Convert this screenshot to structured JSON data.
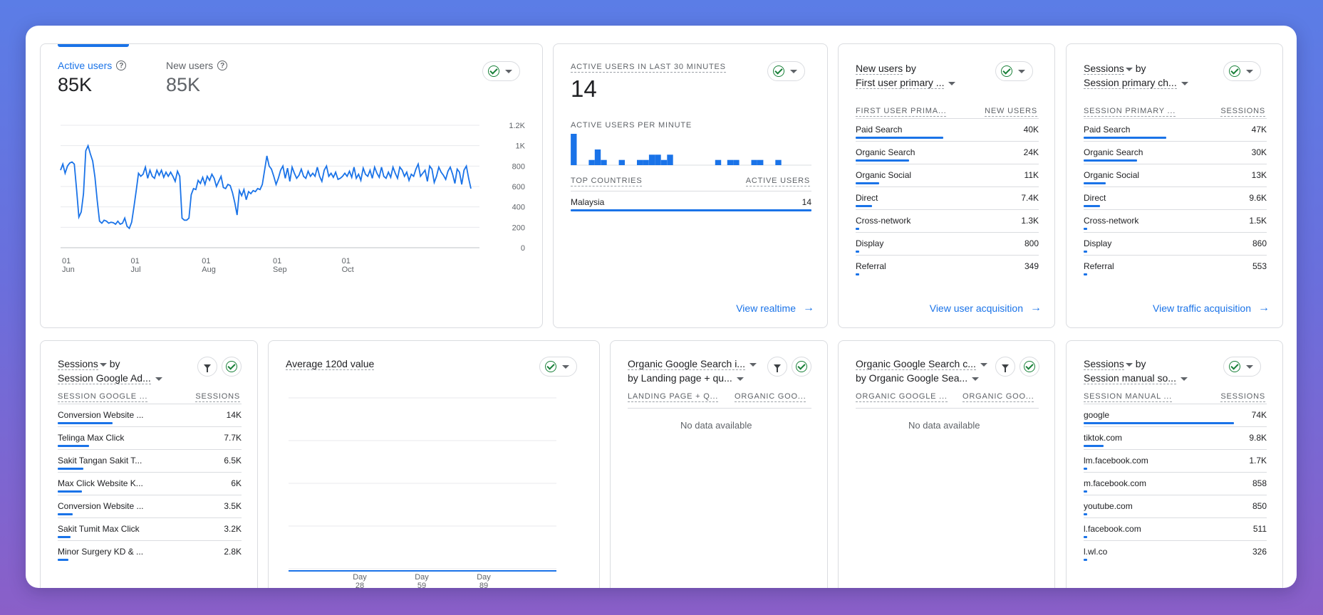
{
  "overview": {
    "metrics": [
      {
        "label": "Active users",
        "value": "85K"
      },
      {
        "label": "New users",
        "value": "85K"
      }
    ],
    "y_ticks": [
      "1.2K",
      "1K",
      "800",
      "600",
      "400",
      "200",
      "0"
    ],
    "x_ticks": [
      {
        "day": "01",
        "month": "Jun"
      },
      {
        "day": "01",
        "month": "Jul"
      },
      {
        "day": "01",
        "month": "Aug"
      },
      {
        "day": "01",
        "month": "Sep"
      },
      {
        "day": "01",
        "month": "Oct"
      }
    ]
  },
  "chart_data": {
    "type": "line",
    "title": "",
    "ylim": [
      0,
      1200
    ],
    "y_tick_values": [
      0,
      200,
      400,
      600,
      800,
      1000,
      1200
    ],
    "series": [
      {
        "name": "Active users",
        "color": "#1a73e8",
        "values": [
          760,
          820,
          730,
          800,
          830,
          840,
          820,
          570,
          300,
          350,
          530,
          950,
          1000,
          920,
          850,
          690,
          460,
          260,
          240,
          270,
          260,
          240,
          250,
          245,
          230,
          260,
          230,
          240,
          290,
          210,
          190,
          250,
          400,
          560,
          730,
          700,
          720,
          790,
          680,
          760,
          700,
          680,
          760,
          710,
          760,
          690,
          740,
          700,
          740,
          700,
          650,
          750,
          700,
          290,
          270,
          270,
          290,
          520,
          580,
          570,
          660,
          630,
          690,
          620,
          700,
          660,
          720,
          680,
          600,
          650,
          700,
          590,
          580,
          620,
          610,
          540,
          440,
          320,
          560,
          510,
          570,
          470,
          550,
          530,
          560,
          550,
          580,
          570,
          620,
          760,
          900,
          800,
          770,
          700,
          620,
          680,
          760,
          800,
          680,
          780,
          650,
          790,
          730,
          680,
          710,
          770,
          700,
          680,
          750,
          700,
          730,
          700,
          790,
          700,
          650,
          760,
          800,
          700,
          730,
          690,
          740,
          670,
          680,
          700,
          730,
          700,
          750,
          690,
          790,
          680,
          720,
          660,
          780,
          720,
          700,
          760,
          680,
          790,
          730,
          690,
          790,
          700,
          680,
          740,
          690,
          790,
          730,
          680,
          790,
          760,
          700,
          740,
          660,
          720,
          700,
          770,
          820,
          700,
          730,
          760,
          650,
          800,
          770,
          640,
          700,
          790,
          740,
          710,
          670,
          750,
          790,
          720,
          630,
          770,
          740,
          620,
          760,
          800,
          680,
          580
        ]
      }
    ]
  },
  "realtime": {
    "title": "ACTIVE USERS IN LAST 30 MINUTES",
    "value": "14",
    "per_minute_label": "ACTIVE USERS PER MINUTE",
    "per_minute": [
      2,
      0,
      0,
      0.33,
      1,
      0.33,
      0,
      0,
      0.33,
      0,
      0,
      0.33,
      0.33,
      0.67,
      0.67,
      0.33,
      0.67,
      0,
      0,
      0,
      0,
      0,
      0,
      0,
      0.33,
      0,
      0.33,
      0.33,
      0,
      0,
      0.33,
      0.33,
      0,
      0,
      0.33,
      0,
      0,
      0,
      0,
      0
    ],
    "countries_label": "TOP COUNTRIES",
    "users_label": "ACTIVE USERS",
    "rows": [
      {
        "label": "Malaysia",
        "value": "14",
        "share": 1.0
      }
    ],
    "link": "View realtime"
  },
  "acquisition": {
    "title_metric": "New users",
    "title_by": "by",
    "title_dimension": "First user primary ...",
    "col1": "FIRST USER PRIMA...",
    "col2": "NEW USERS",
    "rows": [
      {
        "label": "Paid Search",
        "value": "40K",
        "share": 0.48
      },
      {
        "label": "Organic Search",
        "value": "24K",
        "share": 0.29
      },
      {
        "label": "Organic Social",
        "value": "11K",
        "share": 0.13
      },
      {
        "label": "Direct",
        "value": "7.4K",
        "share": 0.09
      },
      {
        "label": "Cross-network",
        "value": "1.3K",
        "share": 0.02
      },
      {
        "label": "Display",
        "value": "800",
        "share": 0.01
      },
      {
        "label": "Referral",
        "value": "349",
        "share": 0.005
      }
    ],
    "link": "View user acquisition"
  },
  "traffic": {
    "title_metric": "Sessions",
    "title_by": "by",
    "title_dimension": "Session primary ch...",
    "col1": "SESSION PRIMARY ...",
    "col2": "SESSIONS",
    "rows": [
      {
        "label": "Paid Search",
        "value": "47K",
        "share": 0.45
      },
      {
        "label": "Organic Search",
        "value": "30K",
        "share": 0.29
      },
      {
        "label": "Organic Social",
        "value": "13K",
        "share": 0.12
      },
      {
        "label": "Direct",
        "value": "9.6K",
        "share": 0.09
      },
      {
        "label": "Cross-network",
        "value": "1.5K",
        "share": 0.015
      },
      {
        "label": "Display",
        "value": "860",
        "share": 0.008
      },
      {
        "label": "Referral",
        "value": "553",
        "share": 0.005
      }
    ],
    "link": "View traffic acquisition"
  },
  "ads": {
    "title_metric": "Sessions",
    "title_by": "by",
    "title_dimension": "Session Google Ad...",
    "col1": "SESSION GOOGLE ...",
    "col2": "SESSIONS",
    "rows": [
      {
        "label": "Conversion Website ...",
        "value": "14K",
        "share": 0.3
      },
      {
        "label": "Telinga Max Click",
        "value": "7.7K",
        "share": 0.17
      },
      {
        "label": "Sakit Tangan Sakit T...",
        "value": "6.5K",
        "share": 0.14
      },
      {
        "label": "Max Click Website K...",
        "value": "6K",
        "share": 0.13
      },
      {
        "label": "Conversion Website ...",
        "value": "3.5K",
        "share": 0.08
      },
      {
        "label": "Sakit Tumit Max Click",
        "value": "3.2K",
        "share": 0.07
      },
      {
        "label": "Minor Surgery KD & ...",
        "value": "2.8K",
        "share": 0.06
      }
    ]
  },
  "avg120": {
    "title": "Average 120d value",
    "x_ticks": [
      {
        "top": "Day",
        "bottom": "28"
      },
      {
        "top": "Day",
        "bottom": "59"
      },
      {
        "top": "Day",
        "bottom": "89"
      }
    ]
  },
  "organic1": {
    "title_line1": "Organic Google Search i...",
    "title_line2": "by Landing page + qu...",
    "col1": "LANDING PAGE + Q...",
    "col2": "ORGANIC GOO...",
    "empty": "No data available"
  },
  "organic2": {
    "title_line1": "Organic Google Search c...",
    "title_line2": "by Organic Google Sea...",
    "col1": "ORGANIC GOOGLE ...",
    "col2": "ORGANIC GOO...",
    "empty": "No data available"
  },
  "manual": {
    "title_metric": "Sessions",
    "title_by": "by",
    "title_dimension": "Session manual so...",
    "col1": "SESSION MANUAL ...",
    "col2": "SESSIONS",
    "rows": [
      {
        "label": "google",
        "value": "74K",
        "share": 0.82
      },
      {
        "label": "tiktok.com",
        "value": "9.8K",
        "share": 0.11
      },
      {
        "label": "lm.facebook.com",
        "value": "1.7K",
        "share": 0.02
      },
      {
        "label": "m.facebook.com",
        "value": "858",
        "share": 0.01
      },
      {
        "label": "youtube.com",
        "value": "850",
        "share": 0.01
      },
      {
        "label": "l.facebook.com",
        "value": "511",
        "share": 0.006
      },
      {
        "label": "l.wl.co",
        "value": "326",
        "share": 0.004
      }
    ]
  },
  "colors": {
    "accent": "#1a73e8",
    "check": "#188038",
    "border": "#dadce0"
  }
}
